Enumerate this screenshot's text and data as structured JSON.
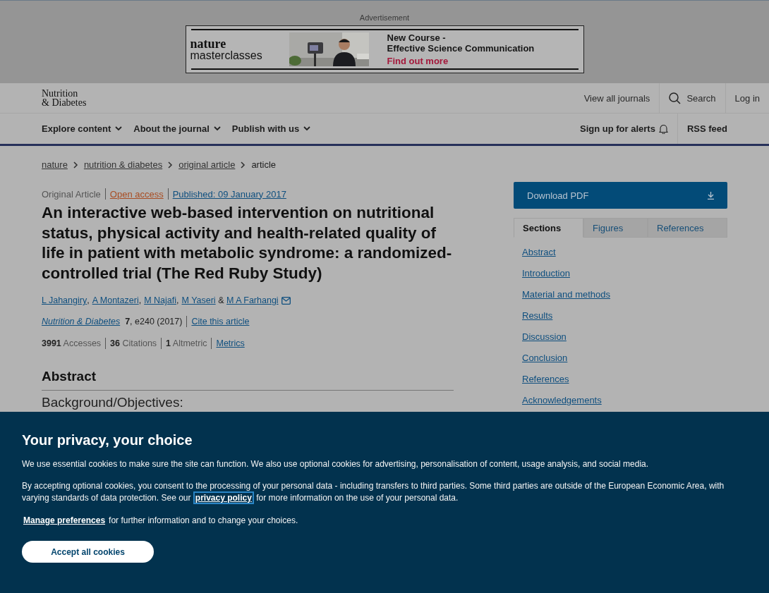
{
  "advert": {
    "label": "Advertisement",
    "brand_line_1": "nature",
    "brand_line_2": "masterclasses",
    "kind": "picture",
    "headline_1": "New Course -",
    "headline_2": "Effective Science Communication",
    "cta": "Find out more"
  },
  "header": {
    "journal_line_1": "Nutrition",
    "journal_line_2": "& Diabetes",
    "links": [
      {
        "label": "View all journals",
        "kind": "text"
      },
      {
        "label": "Search",
        "kind": "search"
      },
      {
        "label": "Log in",
        "kind": "text"
      }
    ]
  },
  "nav": {
    "menus": [
      "Explore content",
      "About the journal",
      "Publish with us"
    ],
    "alerts": "Sign up for alerts",
    "rss": "RSS feed"
  },
  "breadcrumbs": [
    {
      "label": "nature",
      "link": true
    },
    {
      "label": "nutrition & diabetes",
      "link": true
    },
    {
      "label": "original article",
      "link": true
    },
    {
      "label": "article",
      "link": false
    }
  ],
  "article": {
    "type": "Original Article",
    "access": "Open access",
    "published": "Published: 09 January 2017",
    "title": "An interactive web-based intervention on nutritional status, physical activity and health-related quality of life in patient with metabolic syndrome: a randomized-controlled trial (The Red Ruby Study)",
    "authors": [
      "L Jahangiry",
      "A Montazeri",
      "M Najafi",
      "M Yaseri",
      "M A Farhangi"
    ],
    "author_separator": ",",
    "author_conjunction": "&",
    "journal": "Nutrition & Diabetes",
    "volume": "7",
    "pages": ", e240 (2017)",
    "cite": "Cite this article",
    "metrics": [
      "**3991** Accesses",
      "**36** Citations",
      "**1** Altmetric"
    ],
    "metrics_link": "Metrics",
    "abstract_heading": "Abstract",
    "subheading": "Background/Objectives:"
  },
  "sidebar": {
    "download": "Download PDF",
    "tabs": [
      {
        "label": "Sections",
        "selected": true
      },
      {
        "label": "Figures",
        "selected": false
      },
      {
        "label": "References",
        "selected": false
      }
    ],
    "sections": [
      "Abstract",
      "Introduction",
      "Material and methods",
      "Results",
      "Discussion",
      "Conclusion",
      "References",
      "Acknowledgements"
    ]
  },
  "cookie_banner": {
    "title": "Your privacy, your choice",
    "paragraph_1": "We use essential cookies to make sure the site can function. We also use optional cookies for advertising, personalisation of content, usage analysis, and social media.",
    "paragraph_2_before": "By accepting optional cookies, you consent to the processing of your personal data - including transfers to third parties. Some third parties are outside of the European Economic Area, with varying standards of data protection. See our",
    "privacy_link": "privacy policy",
    "paragraph_2_after": "for more information on the use of your personal data.",
    "manage_link": "Manage preferences",
    "manage_text": "for further information and to change your choices.",
    "accept": "Accept all cookies"
  }
}
